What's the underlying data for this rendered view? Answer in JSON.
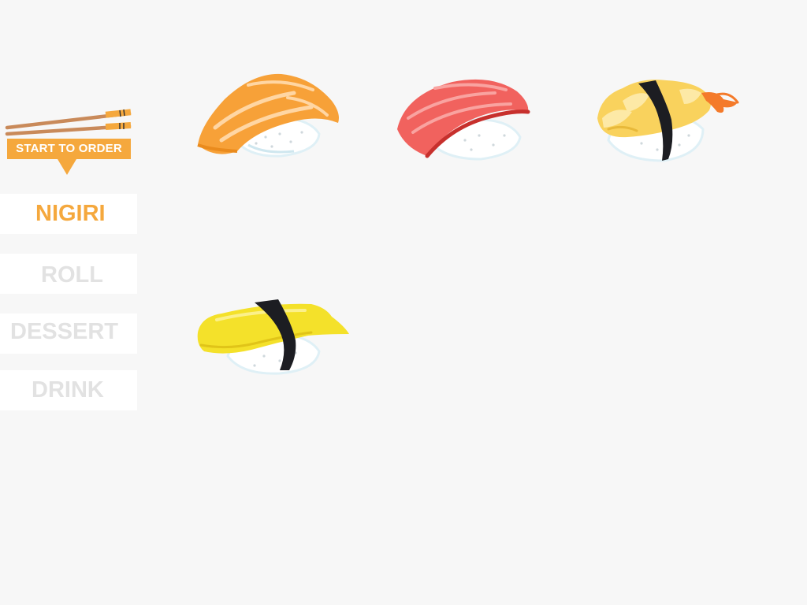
{
  "logo": {
    "banner_text": "START TO ORDER",
    "chopsticks_icon": "chopsticks-icon",
    "color": "#f5a83d"
  },
  "menu": {
    "active": "NIGIRI",
    "active_color": "#f5a83d",
    "inactive_color": "#e2e2e2",
    "items": [
      {
        "label": "NIGIRI"
      },
      {
        "label": "ROLL"
      },
      {
        "label": "DESSERT"
      },
      {
        "label": "DRINK"
      }
    ]
  },
  "products": [
    {
      "icon": "salmon-nigiri-icon",
      "color": "#f7a138"
    },
    {
      "icon": "tuna-nigiri-icon",
      "color": "#f1625e"
    },
    {
      "icon": "shrimp-nigiri-icon",
      "color": "#f9d25d"
    },
    {
      "icon": "tamago-nigiri-icon",
      "color": "#f4e12a"
    }
  ]
}
